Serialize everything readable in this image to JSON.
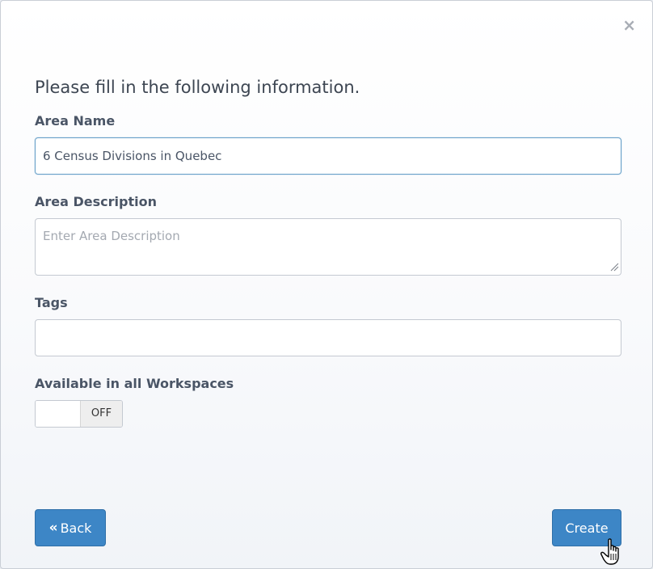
{
  "dialog": {
    "close_symbol": "×",
    "intro": "Please fill in the following information.",
    "area_name": {
      "label": "Area Name",
      "value": "6 Census Divisions in Quebec"
    },
    "area_description": {
      "label": "Area Description",
      "placeholder": "Enter Area Description",
      "value": ""
    },
    "tags": {
      "label": "Tags",
      "value": ""
    },
    "workspaces": {
      "label": "Available in all Workspaces",
      "toggle_state": "OFF"
    },
    "back_button": {
      "label": "Back",
      "icon": "double-chevron-left-icon"
    },
    "create_button": {
      "label": "Create"
    }
  },
  "colors": {
    "primary_button": "#3d86c6",
    "label_text": "#4a5566",
    "focus_border": "#68a0c9"
  },
  "cursor": {
    "icon": "hand-pointer-icon"
  }
}
